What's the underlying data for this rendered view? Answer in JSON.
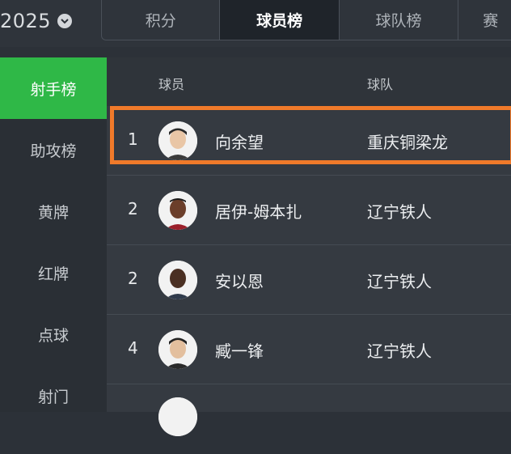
{
  "season": {
    "label": "2025",
    "icon": "chevron-down-icon"
  },
  "tabs": [
    {
      "label": "积分",
      "active": false
    },
    {
      "label": "球员榜",
      "active": true
    },
    {
      "label": "球队榜",
      "active": false
    },
    {
      "label": "赛",
      "active": false
    }
  ],
  "sidebar": {
    "items": [
      {
        "label": "射手榜",
        "active": true
      },
      {
        "label": "助攻榜",
        "active": false
      },
      {
        "label": "黄牌",
        "active": false
      },
      {
        "label": "红牌",
        "active": false
      },
      {
        "label": "点球",
        "active": false
      },
      {
        "label": "射门",
        "active": false
      }
    ]
  },
  "table": {
    "headers": {
      "player": "球员",
      "team": "球队"
    },
    "rows": [
      {
        "rank": "1",
        "player": "向余望",
        "team": "重庆铜梁龙",
        "highlighted": true
      },
      {
        "rank": "2",
        "player": "居伊-姆本扎",
        "team": "辽宁铁人",
        "highlighted": false
      },
      {
        "rank": "2",
        "player": "安以恩",
        "team": "辽宁铁人",
        "highlighted": false
      },
      {
        "rank": "4",
        "player": "臧一锋",
        "team": "辽宁铁人",
        "highlighted": false
      }
    ]
  },
  "colors": {
    "accent_green": "#2fb847",
    "highlight_orange": "#f07a2a",
    "background": "#2c3138"
  }
}
